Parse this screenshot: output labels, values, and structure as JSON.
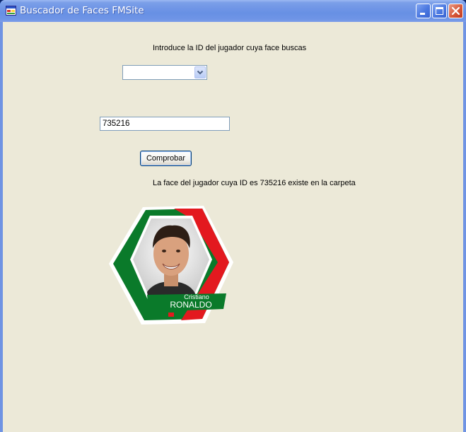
{
  "window": {
    "title": "Buscador de Faces FMSite",
    "controls": [
      "minimize",
      "maximize",
      "close"
    ]
  },
  "form": {
    "prompt_label": "Introduce la ID del jugador cuya face buscas",
    "combo_value": "",
    "id_input_value": "735216",
    "check_button_label": "Comprobar",
    "result_message": "La face del jugador cuya ID es 735216 existe en la carpeta"
  },
  "player_card": {
    "first_name": "Cristiano",
    "last_name": "RONALDO",
    "colors": {
      "green": "#0a7a2a",
      "red": "#e3191f",
      "white": "#ffffff"
    }
  },
  "colors": {
    "titlebar_accent": "#0054e3",
    "client_background": "#ece9d8",
    "close_button": "#d6593c"
  }
}
